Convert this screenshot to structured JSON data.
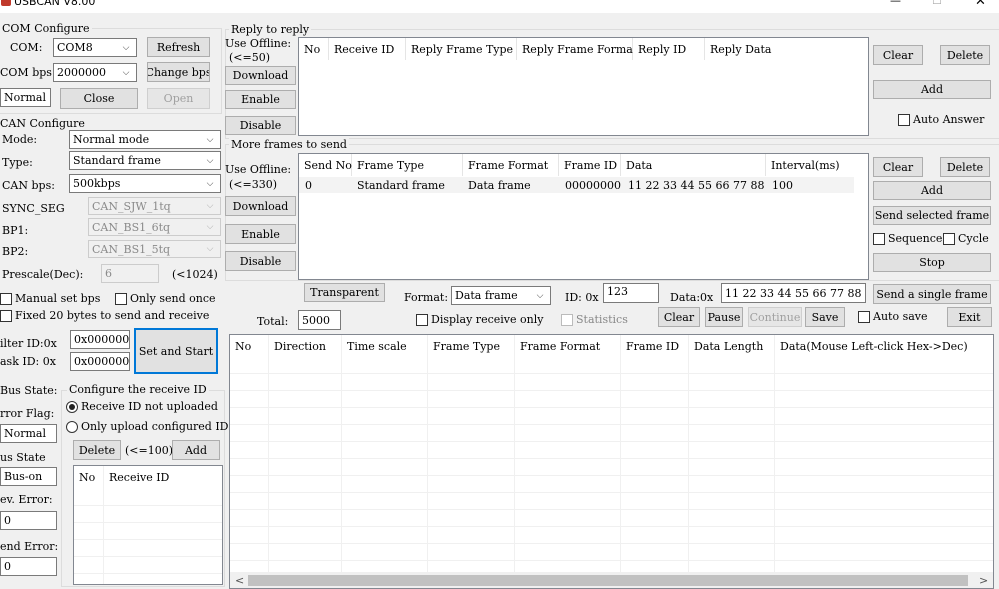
{
  "window": {
    "title": "USBCAN V8.00",
    "minimize_glyph": "—",
    "maximize_glyph": "☐",
    "close_glyph": "✕"
  },
  "com_configure": {
    "title": "COM Configure",
    "com_label": "COM:",
    "com_value": "COM8",
    "refresh": "Refresh",
    "bps_label": "COM bps:",
    "bps_value": "2000000",
    "change_bps": "Change bps",
    "status_value": "Normal",
    "close": "Close",
    "open": "Open"
  },
  "can_configure": {
    "title": "CAN Configure",
    "mode_label": "Mode:",
    "mode_value": "Normal mode",
    "type_label": "Type:",
    "type_value": "Standard frame",
    "canbps_label": "CAN bps:",
    "canbps_value": "500kbps",
    "sync_label": "SYNC_SEG",
    "sync_value": "CAN_SJW_1tq",
    "bp1_label": "BP1:",
    "bp1_value": "CAN_BS1_6tq",
    "bp2_label": "BP2:",
    "bp2_value": "CAN_BS1_5tq",
    "prescale_label": "Prescale(Dec):",
    "prescale_value": "6",
    "prescale_limit": "(<1024)",
    "manual_bps": "Manual set bps",
    "only_send_once": "Only send once",
    "fixed20": "Fixed 20 bytes to send and receive",
    "filter_label": "ilter ID:0x",
    "filter_value": "0x000000",
    "mask_label": "ask ID:  0x",
    "mask_value": "0x000000",
    "set_and_start": "Set and Start"
  },
  "status_panel": {
    "bus_state_label": "Bus State:",
    "error_flag_label": "rror Flag:",
    "error_flag_value": "Normal",
    "bus_state2_label": "us State",
    "bus_state2_value": "Bus-on",
    "rev_error_label": "ev. Error:",
    "rev_error_value": "0",
    "send_error_label": "end Error:",
    "send_error_value": "0"
  },
  "receive_id": {
    "title": "Configure the receive ID",
    "not_uploaded": "Receive ID not uploaded",
    "only_upload": "Only upload configured ID",
    "delete": "Delete",
    "limit": "(<=100)",
    "add": "Add",
    "columns": [
      "No",
      "Receive ID"
    ]
  },
  "reply": {
    "title": "Reply to reply",
    "use_offline": "Use Offline:",
    "limit": "(<=50)",
    "download": "Download",
    "enable": "Enable",
    "disable": "Disable",
    "columns": [
      "No",
      "Receive ID",
      "Reply Frame Type",
      "Reply Frame Format",
      "Reply  ID",
      "Reply Data"
    ],
    "clear": "Clear",
    "delete": "Delete",
    "add": "Add",
    "auto_answer": "Auto Answer"
  },
  "more_frames": {
    "title": "More frames to send",
    "use_offline": "Use Offline:",
    "limit": "(<=330)",
    "download": "Download",
    "enable": "Enable",
    "disable": "Disable",
    "columns": [
      "Send No",
      "Frame Type",
      "Frame Format",
      "Frame ID",
      "Data",
      "Interval(ms)"
    ],
    "rows": [
      [
        "0",
        "Standard frame",
        "Data frame",
        "00000000",
        "11 22 33 44 55 66 77 88",
        "100"
      ]
    ],
    "clear": "Clear",
    "delete": "Delete",
    "add": "Add",
    "send_selected": "Send selected frame",
    "sequence": "Sequence",
    "cycle": "Cycle",
    "stop": "Stop"
  },
  "send_bar": {
    "transparent": "Transparent",
    "format_label": "Format:",
    "format_value": "Data frame",
    "id_label": "ID: 0x",
    "id_value": "123",
    "data_label": "Data:0x",
    "data_value": "11 22 33 44 55 66 77 88",
    "send_single": "Send a single frame",
    "total_label": "Total:",
    "total_value": "5000",
    "display_receive_only": "Display receive only",
    "statistics": "Statistics",
    "clear": "Clear",
    "pause": "Pause",
    "continue": "Continue",
    "save": "Save",
    "auto_save": "Auto save",
    "exit": "Exit"
  },
  "log_table": {
    "columns": [
      "No",
      "Direction",
      "Time scale",
      "Frame Type",
      "Frame Format",
      "Frame ID",
      "Data Length",
      "Data(Mouse Left-click Hex->Dec)"
    ],
    "scroll_left": "<",
    "scroll_right": ">"
  },
  "colors": {
    "bg": "#f0f0f0",
    "button": "#e1e1e1",
    "focus": "#0078d7",
    "selected_row": "#f3f3f3"
  }
}
